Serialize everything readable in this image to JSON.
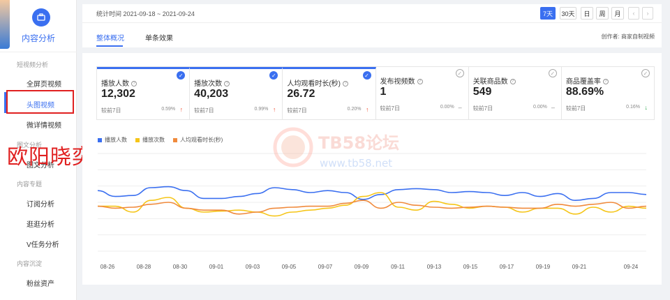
{
  "sidebar": {
    "module_title": "内容分析",
    "groups": [
      {
        "label": "短视频分析"
      },
      {
        "label": "图文分析"
      },
      {
        "label": "内容专题"
      },
      {
        "label": "内容沉淀"
      }
    ],
    "items": [
      {
        "label": "全屏页视频"
      },
      {
        "label": "头图视频"
      },
      {
        "label": "微详情视频"
      },
      {
        "label": "图文分析"
      },
      {
        "label": "订阅分析"
      },
      {
        "label": "逛逛分析"
      },
      {
        "label": "V任务分析"
      },
      {
        "label": "粉丝资产"
      }
    ],
    "active_item": "头图视频",
    "overlay_text": "欧阳晓奕"
  },
  "header": {
    "stat_time": "统计时间 2021-09-18 ~ 2021-09-24",
    "ranges": [
      "7天",
      "30天",
      "日",
      "周",
      "月"
    ],
    "active_range": "7天",
    "tabs": [
      "整体概况",
      "单条效果"
    ],
    "active_tab": "整体概况",
    "creator": "创作者: 商家自制视频"
  },
  "cards": [
    {
      "label": "播放人数",
      "value": "12,302",
      "compare": "较前7日",
      "pct": "0.59%",
      "trend": "up",
      "selected": true
    },
    {
      "label": "播放次数",
      "value": "40,203",
      "compare": "较前7日",
      "pct": "0.99%",
      "trend": "up",
      "selected": true
    },
    {
      "label": "人均观看时长(秒)",
      "value": "26.72",
      "compare": "较前7日",
      "pct": "0.20%",
      "trend": "up",
      "selected": true
    },
    {
      "label": "发布视频数",
      "value": "1",
      "compare": "较前7日",
      "pct": "0.00%",
      "trend": "flat",
      "selected": false
    },
    {
      "label": "关联商品数",
      "value": "549",
      "compare": "较前7日",
      "pct": "0.00%",
      "trend": "flat",
      "selected": false
    },
    {
      "label": "商品覆盖率",
      "value": "88.69%",
      "compare": "较前7日",
      "pct": "0.16%",
      "trend": "down",
      "selected": false
    }
  ],
  "colors": {
    "accent": "#3a6ff0",
    "up": "#f04d2f",
    "down": "#2fa84f",
    "series1": "#3a6ff0",
    "series2": "#f5c518",
    "series3": "#f08a3c"
  },
  "watermark": {
    "text": "TB58论坛",
    "url": "www.tb58.net"
  },
  "chart_data": {
    "type": "line",
    "x_ticks": [
      "08-26",
      "08-28",
      "08-30",
      "09-01",
      "09-03",
      "09-05",
      "09-07",
      "09-09",
      "09-11",
      "09-13",
      "09-15",
      "09-17",
      "09-19",
      "09-21",
      "09-24"
    ],
    "series": [
      {
        "name": "播放人数",
        "color": "#3a6ff0",
        "values": [
          0.62,
          0.56,
          0.57,
          0.65,
          0.66,
          0.62,
          0.54,
          0.54,
          0.56,
          0.59,
          0.65,
          0.63,
          0.6,
          0.62,
          0.6,
          0.53,
          0.58,
          0.63,
          0.64,
          0.63,
          0.6,
          0.61,
          0.6,
          0.57,
          0.6,
          0.56,
          0.59,
          0.52,
          0.54,
          0.6,
          0.6,
          0.58
        ]
      },
      {
        "name": "播放次数",
        "color": "#f5c518",
        "values": [
          0.46,
          0.46,
          0.4,
          0.52,
          0.55,
          0.44,
          0.4,
          0.41,
          0.42,
          0.4,
          0.36,
          0.4,
          0.42,
          0.44,
          0.47,
          0.56,
          0.6,
          0.45,
          0.42,
          0.51,
          0.48,
          0.44,
          0.46,
          0.45,
          0.4,
          0.44,
          0.44,
          0.38,
          0.45,
          0.4,
          0.46,
          0.44
        ]
      },
      {
        "name": "人均观看时长(秒)",
        "color": "#f08a3c",
        "values": [
          0.46,
          0.44,
          0.45,
          0.48,
          0.5,
          0.44,
          0.42,
          0.42,
          0.38,
          0.4,
          0.44,
          0.45,
          0.46,
          0.46,
          0.49,
          0.52,
          0.44,
          0.5,
          0.47,
          0.45,
          0.44,
          0.45,
          0.46,
          0.45,
          0.44,
          0.44,
          0.48,
          0.46,
          0.48,
          0.5,
          0.44,
          0.46
        ]
      }
    ],
    "grid": true,
    "legend": "top-left"
  }
}
